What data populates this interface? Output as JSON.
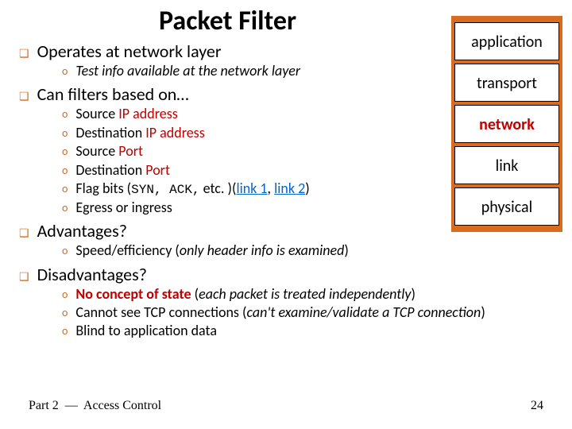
{
  "title": "Packet Filter",
  "sections": [
    {
      "heading": "Operates at network layer",
      "items": [
        {
          "pre": "Test info available at the network layer",
          "preItalic": true
        }
      ]
    },
    {
      "heading": "Can filters based on…",
      "items": [
        {
          "pre": "Source ",
          "red": "IP address"
        },
        {
          "pre": "Destination ",
          "red": "IP address"
        },
        {
          "pre": "Source ",
          "red": "Port"
        },
        {
          "pre": "Destination ",
          "red": "Port"
        },
        {
          "pre": "Flag bits (",
          "syn": "SYN, ACK,",
          "post1": " etc. )(",
          "link1": "link 1",
          "comma": ", ",
          "link2": "link 2",
          "post2": ")"
        },
        {
          "pre": "Egress or ingress"
        }
      ]
    },
    {
      "heading": "Advantages?",
      "items": [
        {
          "pre": "Speed/efficiency (",
          "italic": "only header info is examined",
          "post": ")"
        }
      ]
    },
    {
      "heading": "Disadvantages?",
      "items": [
        {
          "redbold": "No concept of state",
          "post": " (",
          "italic": "each packet is treated independently",
          "post2": ")"
        },
        {
          "pre": "Cannot see TCP connections (",
          "italic": "can't examine/validate a TCP connection",
          "post": ")"
        },
        {
          "pre": "Blind to application data"
        }
      ]
    }
  ],
  "stack": [
    "application",
    "transport",
    "network",
    "link",
    "physical"
  ],
  "footer": {
    "part": "Part 2 ",
    "dash": "—",
    "rest": " Access Control",
    "page": "24"
  }
}
